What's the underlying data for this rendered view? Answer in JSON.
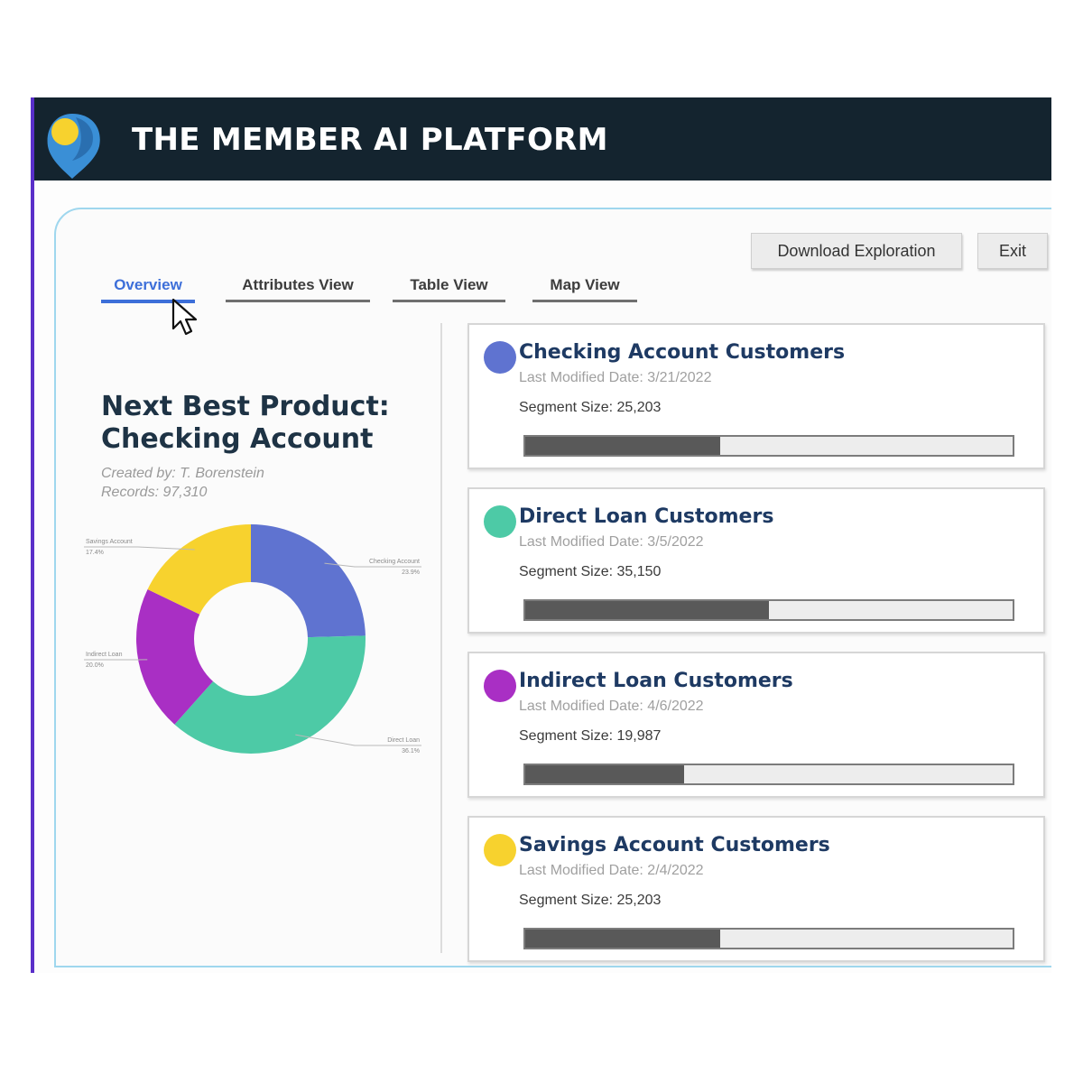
{
  "app": {
    "title": "THE MEMBER AI PLATFORM"
  },
  "toolbar": {
    "download_label": "Download Exploration",
    "exit_label": "Exit"
  },
  "tabs": [
    {
      "label": "Overview",
      "active": true
    },
    {
      "label": "Attributes View",
      "active": false
    },
    {
      "label": "Table  View",
      "active": false
    },
    {
      "label": "Map  View",
      "active": false
    }
  ],
  "overview": {
    "title_line1": "Next Best Product:",
    "title_line2": "Checking Account",
    "created_by": "Created by: T. Borenstein",
    "records": "Records: 97,310"
  },
  "chart_data": {
    "type": "pie",
    "donut": true,
    "slices": [
      {
        "label": "Checking Account",
        "value": 23.9,
        "value_label": "23.9%",
        "color": "#5f73d0"
      },
      {
        "label": "Direct Loan",
        "value": 36.1,
        "value_label": "36.1%",
        "color": "#4dcaa6"
      },
      {
        "label": "Indirect Loan",
        "value": 20.0,
        "value_label": "20.0%",
        "color": "#a92fc4"
      },
      {
        "label": "Savings Account",
        "value": 17.4,
        "value_label": "17.4%",
        "color": "#f7d22e"
      }
    ]
  },
  "segments": [
    {
      "title": "Checking Account Customers",
      "modified": "Last Modified Date: 3/21/2022",
      "size": "Segment Size: 25,203",
      "fill": 0.4,
      "color": "#5f73d0"
    },
    {
      "title": "Direct Loan Customers",
      "modified": "Last Modified Date: 3/5/2022",
      "size": "Segment Size: 35,150",
      "fill": 0.5,
      "color": "#4dcaa6"
    },
    {
      "title": "Indirect Loan Customers",
      "modified": "Last Modified Date: 4/6/2022",
      "size": "Segment Size: 19,987",
      "fill": 0.325,
      "color": "#a92fc4"
    },
    {
      "title": "Savings Account Customers",
      "modified": "Last Modified Date: 2/4/2022",
      "size": "Segment Size: 25,203",
      "fill": 0.4,
      "color": "#f7d22e"
    }
  ],
  "colors": {
    "header": "#14242f",
    "accent": "#3d6fd9",
    "logo_blue": "#3a8fd6",
    "logo_yellow": "#f7d22e"
  },
  "icons": {
    "logo": "location-pin-logo",
    "cursor": "arrow-cursor-icon"
  }
}
